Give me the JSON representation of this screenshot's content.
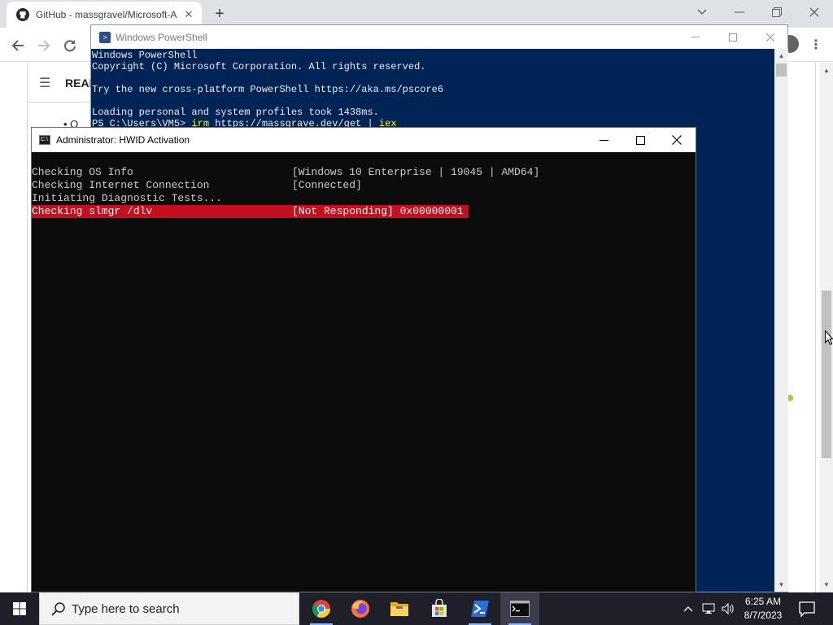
{
  "browser": {
    "tab_title": "GitHub - massgravel/Microsoft-A",
    "tab_close": "✕",
    "new_tab": "+",
    "page": {
      "readme_label": "README",
      "bullet_text": "• O"
    }
  },
  "powershell": {
    "title": "Windows PowerShell",
    "lines": [
      "Windows PowerShell",
      "Copyright (C) Microsoft Corporation. All rights reserved.",
      "",
      "Try the new cross-platform PowerShell https://aka.ms/pscore6",
      "",
      "Loading personal and system profiles took 1438ms."
    ],
    "prompt": "PS C:\\Users\\VM5> ",
    "cmd_irm": "irm",
    "cmd_url": " https://massgrave.dev/get | ",
    "cmd_iex": "iex"
  },
  "console": {
    "title": "Administrator:  HWID Activation",
    "rows": [
      {
        "label": "Checking OS Info",
        "value": "[Windows 10 Enterprise | 19045 | AMD64]"
      },
      {
        "label": "Checking Internet Connection",
        "value": "[Connected]"
      },
      {
        "label": "Initiating Diagnostic Tests...",
        "value": ""
      },
      {
        "label": "Checking slmgr /dlv",
        "value": "[Not Responding] 0x00000001"
      }
    ]
  },
  "taskbar": {
    "search_placeholder": "Type here to search",
    "time": "6:25 AM",
    "date": "8/7/2023"
  },
  "colors": {
    "ps_background": "#012456",
    "console_background": "#0c0c0c",
    "error_highlight": "#c50f1f",
    "taskbar_background": "#1f1f2a"
  }
}
